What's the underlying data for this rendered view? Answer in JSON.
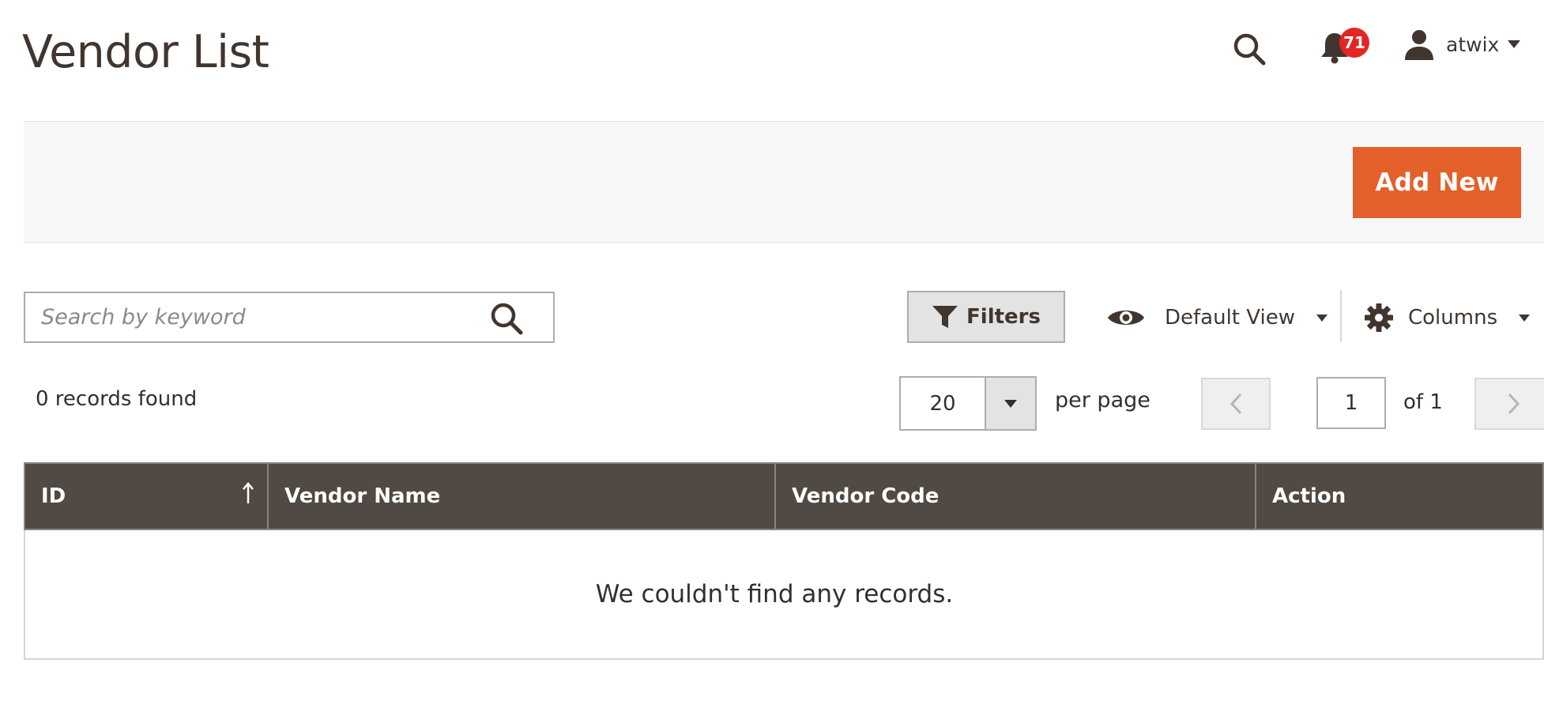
{
  "header": {
    "title": "Vendor List",
    "notifications_count": "71",
    "username": "atwix"
  },
  "actions": {
    "add_new_label": "Add New"
  },
  "toolbar": {
    "search_placeholder": "Search by keyword",
    "search_value": "",
    "filters_label": "Filters",
    "view_label": "Default View",
    "columns_label": "Columns"
  },
  "pagination": {
    "records_found": "0 records found",
    "per_page_value": "20",
    "per_page_label": "per page",
    "current_page": "1",
    "total_pages_label": "of 1"
  },
  "grid": {
    "columns": [
      {
        "label": "ID",
        "sort": "ascending"
      },
      {
        "label": "Vendor Name"
      },
      {
        "label": "Vendor Code"
      },
      {
        "label": "Action"
      }
    ],
    "empty_message": "We couldn't find any records."
  },
  "colors": {
    "accent": "#e3602b",
    "grid_header": "#514943",
    "badge": "#e22626",
    "title": "#41362f"
  },
  "icons": {
    "header_search": "search-icon",
    "notifications": "bell-icon",
    "user": "user-icon",
    "search_submit": "search-icon",
    "filters": "funnel-icon",
    "view": "eye-icon",
    "columns": "gear-icon",
    "dropdown": "caret-down-icon",
    "pager_prev": "chevron-left-icon",
    "pager_next": "chevron-right-icon",
    "sort": "arrow-up-icon"
  }
}
